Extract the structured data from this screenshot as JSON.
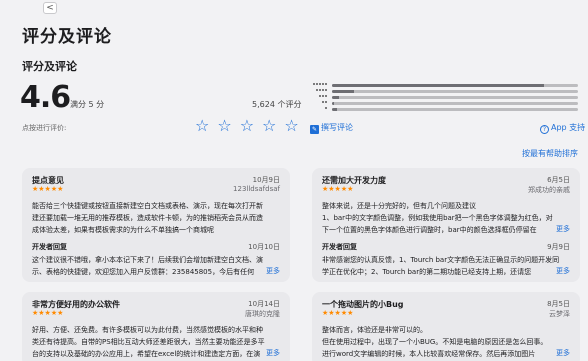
{
  "window": {
    "back_glyph": "<"
  },
  "page_title": "评分及评论",
  "section_title": "评分及评论",
  "rating": {
    "value": "4.6",
    "out_of": "满分 5 分",
    "count": "5,624 个评分"
  },
  "histogram": [
    0.86,
    0.09,
    0.03,
    0.01,
    0.02
  ],
  "tap_to_rate": {
    "label": "点按进行评价:",
    "stars": "☆☆☆☆☆"
  },
  "write_review": "撰写评论",
  "app_support": "App 支持",
  "sort_label": "按最有帮助排序",
  "colors": {
    "accent": "#1f6fd6",
    "star": "#ff8a00",
    "card_bg": "#e9e9ec"
  },
  "reviews": [
    {
      "title": "提点意见",
      "date": "10月9日",
      "stars": "★★★★★",
      "author": "123lldsafdsaf",
      "body": [
        "能否给三个快捷键或按钮直接新建空白文档或表格、演示，现在每次打开新",
        "建还要加载一堆无用的推荐模板，造成软件卡顿，为的推销稻壳会员从而造",
        "成体验太差，如果有模板需求的为什么不单独搞一个商城呢"
      ],
      "dev": {
        "title": "开发者回复",
        "date": "10月10日",
        "body": [
          "这个建议很不错哦，拿小本本记下来了！后续我们会增加新建空白文档、演",
          "示、表格的快捷键，欢迎您加入用户反馈群：235845805，今后有任何"
        ],
        "more": "更多"
      }
    },
    {
      "title": "还需加大开发力度",
      "date": "6月5日",
      "stars": "★★★★★",
      "author": "郑成功的亲戚",
      "body": [
        "整体来说，还是十分完好的，但有几个问题及建议",
        "1、bar中的文字颜色调整，例如我使用bar把一个黑色字体调整为红色，对",
        "下一个位置的黑色字体颜色进行调整时，bar中的颜色选择框仍停留在"
      ],
      "more": "更多",
      "dev": {
        "title": "开发者回复",
        "date": "9月9日",
        "body": [
          "非常感谢您的认真反馈，1、Tourch bar文字颜色无法正确显示的问题开发同",
          "学正在优化中；2、Tourch bar的第二期功能已经支持上期，还请您"
        ],
        "more": "更多"
      }
    },
    {
      "title": "非常方便好用的办公软件",
      "date": "10月14日",
      "stars": "★★★★★",
      "author": "唐琪的克隆",
      "body": [
        "好用、方便、还免费。有许多模板可以为此付费，当然感觉模板的水平和种",
        "类还有待提高。自带的PS相比互动大师还差距很大，当然主要功能还是多平",
        "台的支持以及基础的办公应用上，希望在excel的统计和建造定方面，在演"
      ],
      "more": "更多"
    },
    {
      "title": "一个拖动图片的小Bug",
      "date": "8月5日",
      "stars": "★★★★★",
      "author": "云梦泽",
      "body": [
        "整体而言，体验还是非常可以的。",
        "但在使用过程中，出现了一个小BUG。不知是电脑的原因还是怎么回事。",
        "进行word文字编辑的时候，本人比较喜欢经常保存。然后再添加图片"
      ],
      "more": "更多"
    }
  ]
}
